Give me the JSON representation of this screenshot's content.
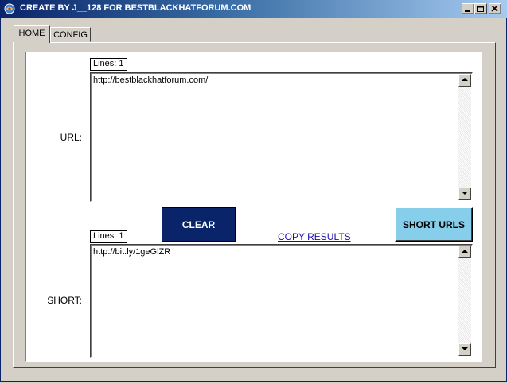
{
  "window": {
    "title": "CREATE BY J__128 FOR BESTBLACKHATFORUM.COM",
    "controls": {
      "minimize_icon": "minimize-icon",
      "maximize_icon": "maximize-icon",
      "close_icon": "close-icon"
    }
  },
  "tabs": [
    {
      "label": "HOME",
      "active": true
    },
    {
      "label": "CONFIG",
      "active": false
    }
  ],
  "url_section": {
    "lines_label": "Lines: 1",
    "label": "URL:",
    "value": "http://bestblackhatforum.com/"
  },
  "actions": {
    "clear_label": "CLEAR",
    "copy_label": "COPY RESULTS",
    "short_label": "SHORT URLS"
  },
  "short_section": {
    "lines_label": "Lines: 1",
    "label": "SHORT:",
    "value": "http://bit.ly/1geGlZR"
  },
  "colors": {
    "titlebar_start": "#0a246a",
    "titlebar_end": "#a6caf0",
    "clear_button": "#0a246a",
    "short_button": "#87ceeb",
    "link": "#1a0dab"
  }
}
